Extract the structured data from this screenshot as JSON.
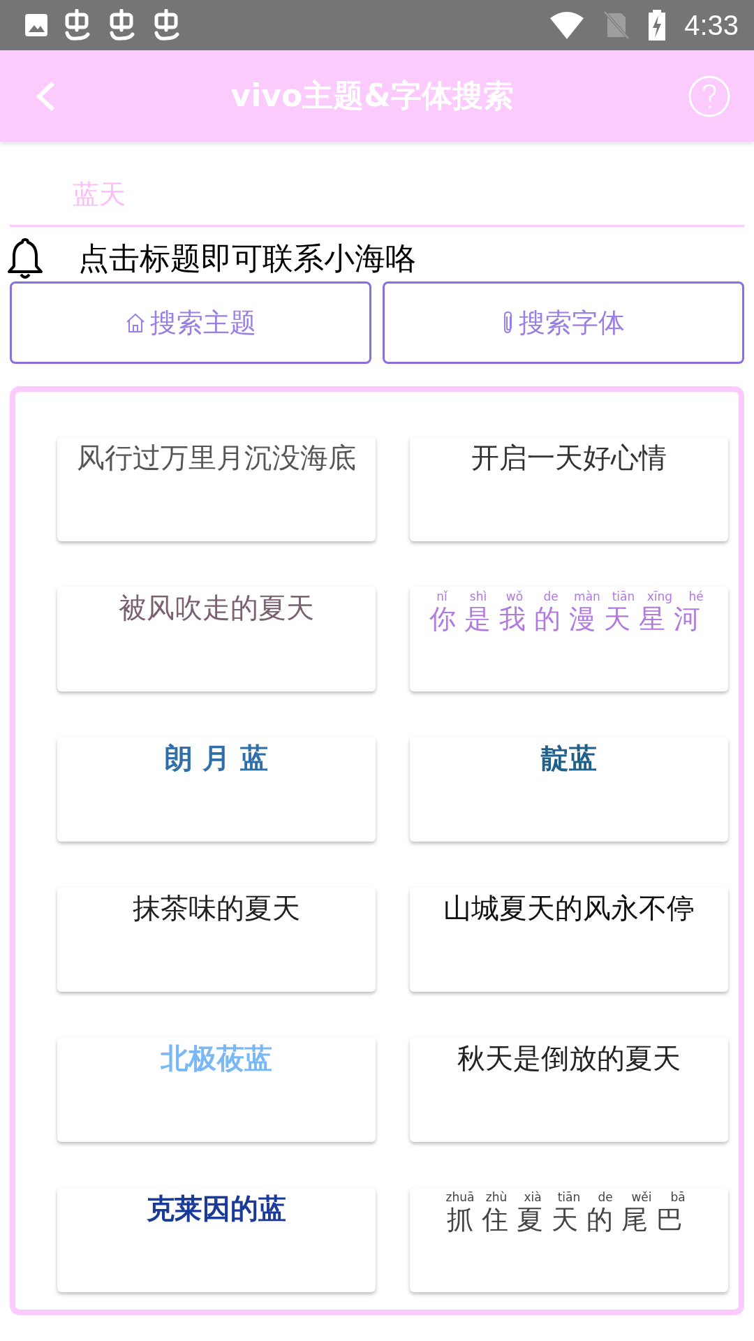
{
  "status_bar": {
    "time": "4:33"
  },
  "header": {
    "title": "vivo主题&字体搜索"
  },
  "search": {
    "placeholder": "蓝天"
  },
  "notice": {
    "text": "点击标题即可联系小海咯"
  },
  "buttons": [
    {
      "label": "搜索主题",
      "kind": "home"
    },
    {
      "label": "搜索字体",
      "kind": "clip"
    }
  ],
  "cards": [
    {
      "title": "风行过万里月沉没海底",
      "color": "#555555",
      "bold": false
    },
    {
      "title": "开启一天好心情",
      "color": "#333333",
      "bold": false
    },
    {
      "title": "被风吹走的夏天",
      "color": "#7a6070",
      "bold": false
    },
    {
      "title": "你是我的漫天星河",
      "color": "#b07ae0",
      "bold": false,
      "pinyin": [
        "nǐ",
        "shì",
        "wǒ",
        "de",
        "màn",
        "tiān",
        "xīng",
        "hé"
      ]
    },
    {
      "title": "朗 月 蓝",
      "color": "#2f6ea8",
      "bold": true
    },
    {
      "title": "靛蓝",
      "color": "#1f5f8a",
      "bold": true
    },
    {
      "title": "抹茶味的夏天",
      "color": "#222222",
      "bold": false
    },
    {
      "title": "山城夏天的风永不停",
      "color": "#111111",
      "bold": false
    },
    {
      "title": "北极莜蓝",
      "color": "#7ab8f5",
      "bold": true
    },
    {
      "title": "秋天是倒放的夏天",
      "color": "#222222",
      "bold": false
    },
    {
      "title": "克莱因的蓝",
      "color": "#1a3a9a",
      "bold": true
    },
    {
      "title": "抓住夏天的尾巴",
      "color": "#444444",
      "bold": false,
      "pinyin": [
        "zhuā",
        "zhù",
        "xià",
        "tiān",
        "de",
        "wěi",
        "bā"
      ]
    }
  ]
}
